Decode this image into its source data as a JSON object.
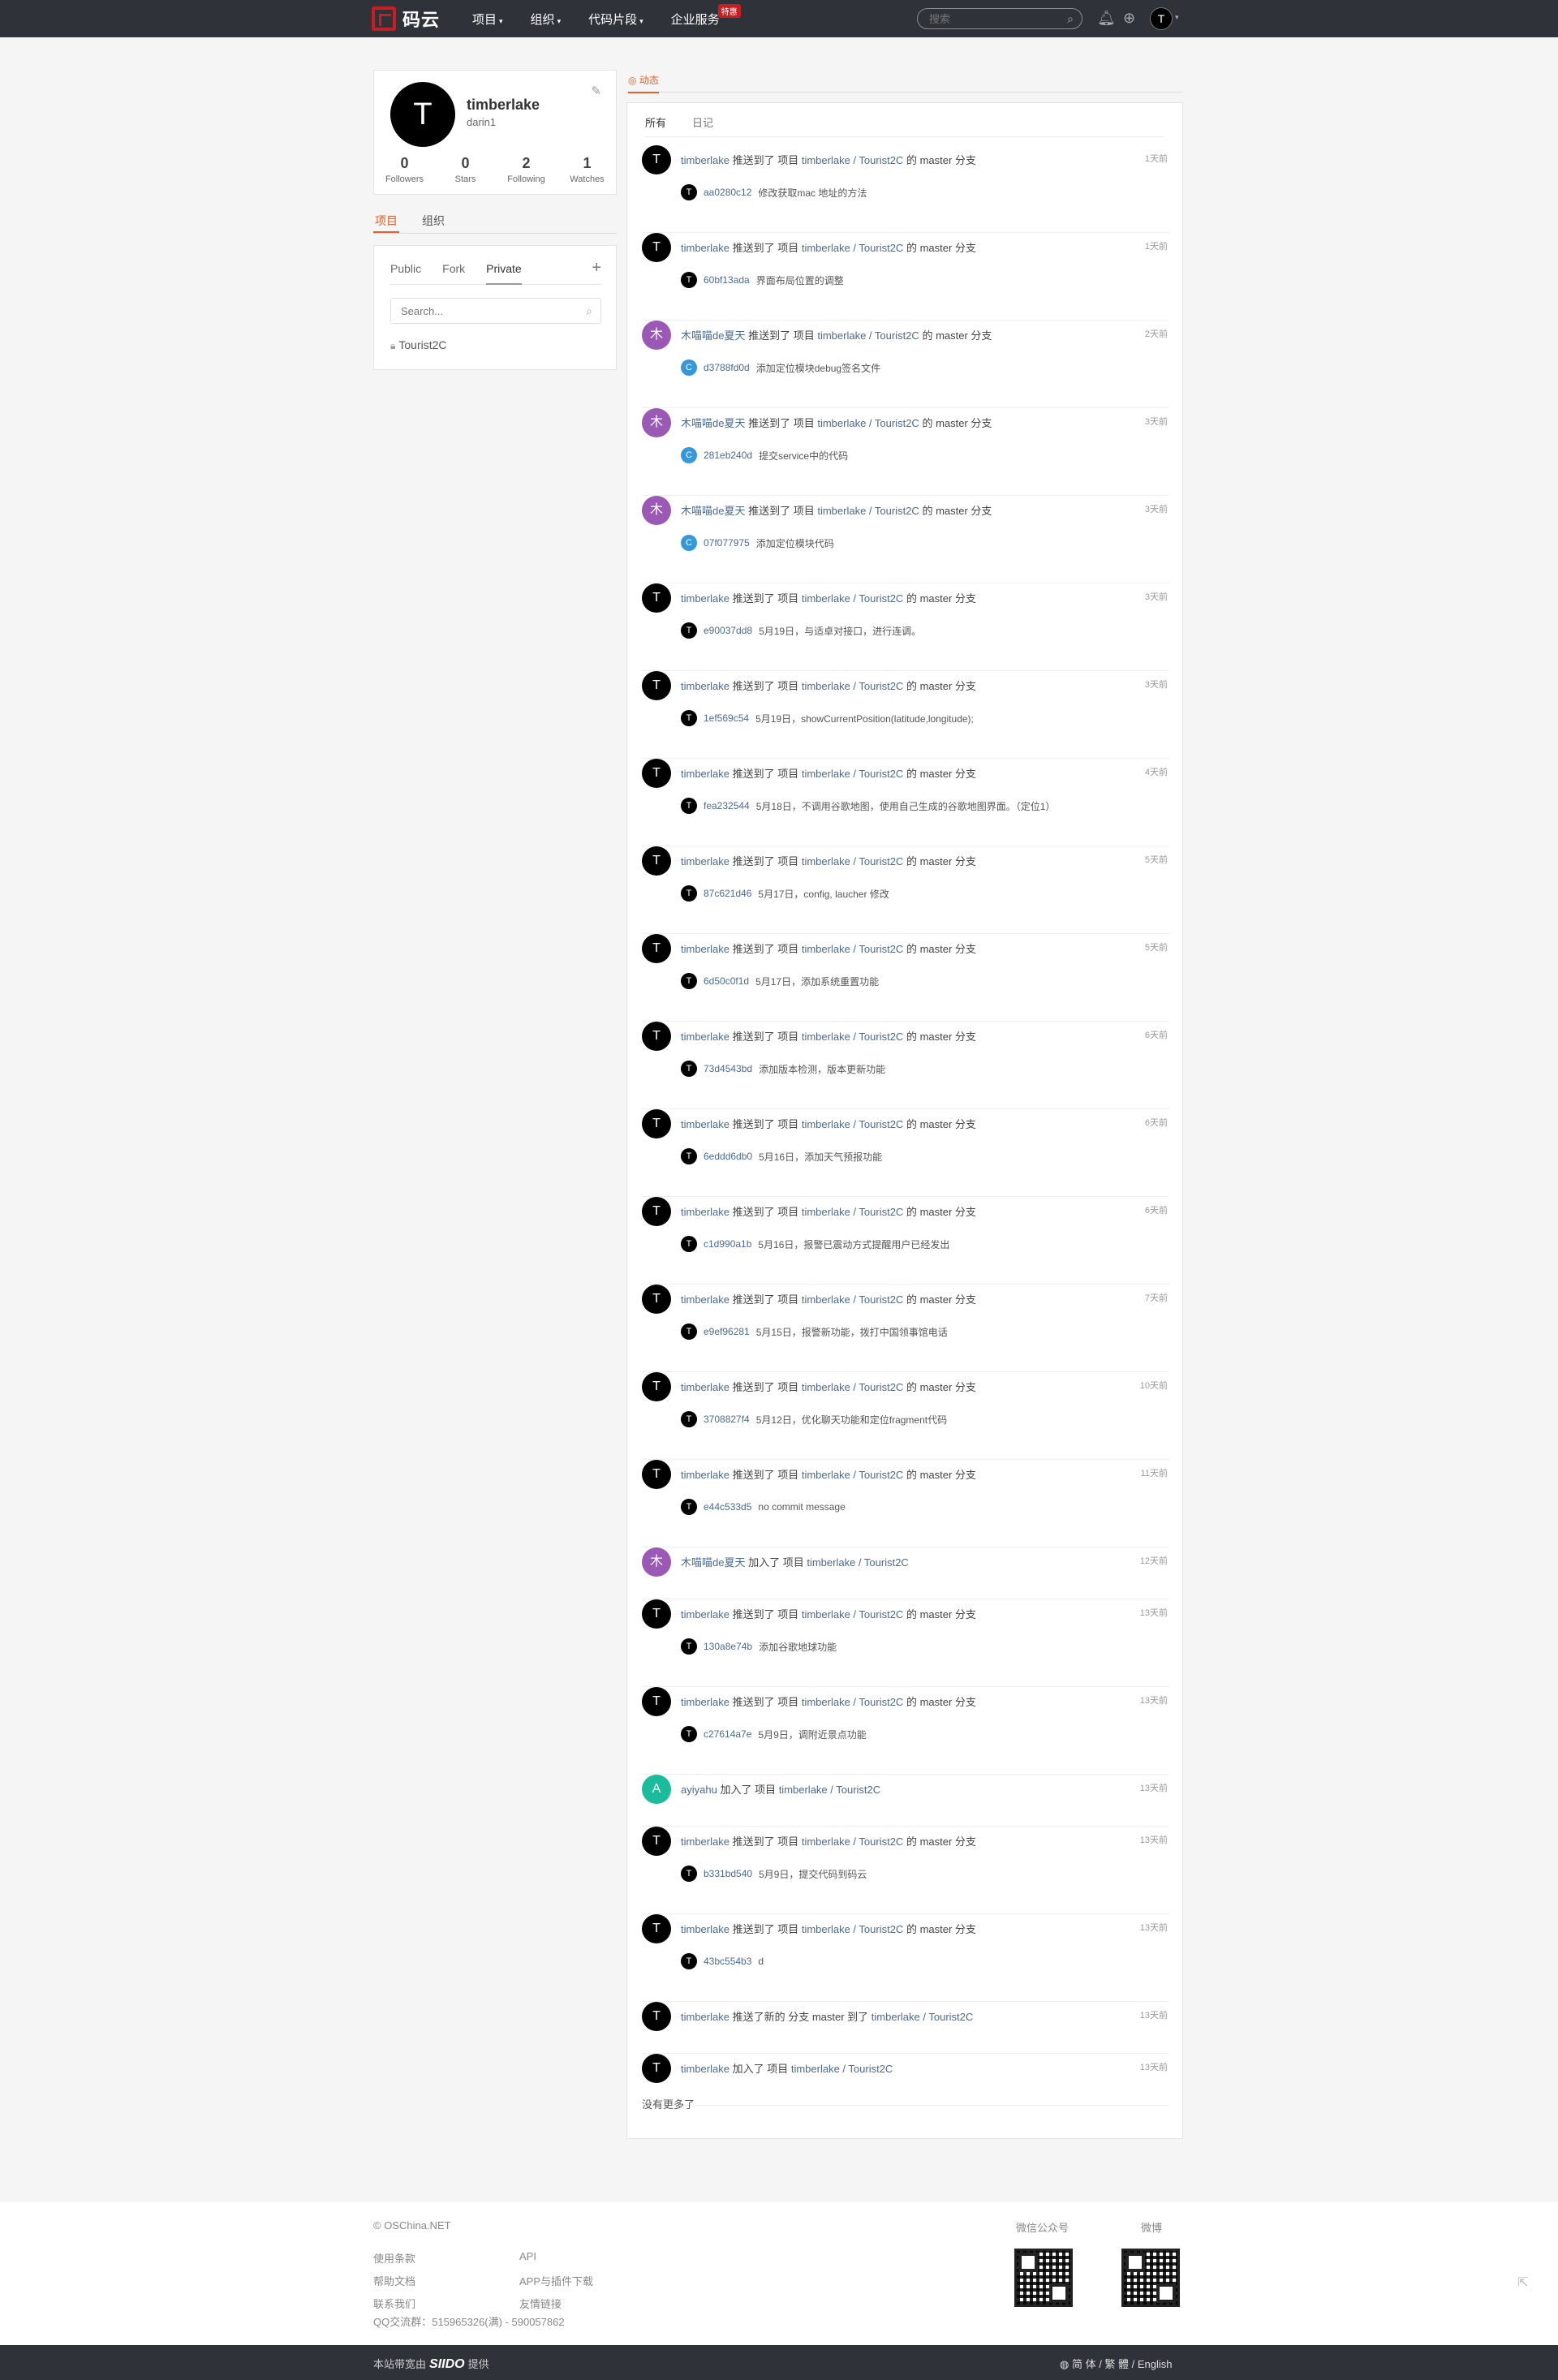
{
  "header": {
    "logo_text": "码云",
    "nav": [
      {
        "label": "项目"
      },
      {
        "label": "组织"
      },
      {
        "label": "代码片段"
      },
      {
        "label": "企业服务",
        "badge": "特惠"
      }
    ],
    "search_placeholder": "搜索",
    "user_avatar_letter": "T"
  },
  "profile": {
    "avatar_letter": "T",
    "name": "timberlake",
    "login": "darin1",
    "stats": [
      {
        "num": "0",
        "label": "Followers"
      },
      {
        "num": "0",
        "label": "Stars"
      },
      {
        "num": "2",
        "label": "Following"
      },
      {
        "num": "1",
        "label": "Watches"
      }
    ]
  },
  "side_tabs": [
    "项目",
    "组织"
  ],
  "repos": {
    "tabs": [
      "Public",
      "Fork",
      "Private"
    ],
    "search_placeholder": "Search...",
    "items": [
      "Tourist2C"
    ]
  },
  "main_tabs": [
    "动态"
  ],
  "sub_tabs": [
    "所有",
    "日记"
  ],
  "events": [
    {
      "av": "T",
      "color": "#000000",
      "actor": "timberlake",
      "verb": "推送到了 项目",
      "repo": "timberlake / Tourist2C",
      "tail": "的 master 分支",
      "time": "1天前",
      "sha": "aa0280c12",
      "msg": "修改获取mac 地址的方法",
      "cav": "T",
      "ccolor": "#000000"
    },
    {
      "av": "T",
      "color": "#000000",
      "actor": "timberlake",
      "verb": "推送到了 项目",
      "repo": "timberlake / Tourist2C",
      "tail": "的 master 分支",
      "time": "1天前",
      "sha": "60bf13ada",
      "msg": "界面布局位置的调整",
      "cav": "T",
      "ccolor": "#000000"
    },
    {
      "av": "木",
      "color": "#9b59b6",
      "actor": "木喵喵de夏天",
      "verb": "推送到了 项目",
      "repo": "timberlake / Tourist2C",
      "tail": "的 master 分支",
      "time": "2天前",
      "sha": "d3788fd0d",
      "msg": "添加定位模块debug签名文件",
      "cav": "C",
      "ccolor": "#3498db"
    },
    {
      "av": "木",
      "color": "#9b59b6",
      "actor": "木喵喵de夏天",
      "verb": "推送到了 项目",
      "repo": "timberlake / Tourist2C",
      "tail": "的 master 分支",
      "time": "3天前",
      "sha": "281eb240d",
      "msg": "提交service中的代码",
      "cav": "C",
      "ccolor": "#3498db"
    },
    {
      "av": "木",
      "color": "#9b59b6",
      "actor": "木喵喵de夏天",
      "verb": "推送到了 项目",
      "repo": "timberlake / Tourist2C",
      "tail": "的 master 分支",
      "time": "3天前",
      "sha": "07f077975",
      "msg": "添加定位模块代码",
      "cav": "C",
      "ccolor": "#3498db"
    },
    {
      "av": "T",
      "color": "#000000",
      "actor": "timberlake",
      "verb": "推送到了 项目",
      "repo": "timberlake / Tourist2C",
      "tail": "的 master 分支",
      "time": "3天前",
      "sha": "e90037dd8",
      "msg": "5月19日，与适卓对接口，进行连调。",
      "cav": "T",
      "ccolor": "#000000"
    },
    {
      "av": "T",
      "color": "#000000",
      "actor": "timberlake",
      "verb": "推送到了 项目",
      "repo": "timberlake / Tourist2C",
      "tail": "的 master 分支",
      "time": "3天前",
      "sha": "1ef569c54",
      "msg": "5月19日，showCurrentPosition(latitude,longitude);",
      "cav": "T",
      "ccolor": "#000000"
    },
    {
      "av": "T",
      "color": "#000000",
      "actor": "timberlake",
      "verb": "推送到了 项目",
      "repo": "timberlake / Tourist2C",
      "tail": "的 master 分支",
      "time": "4天前",
      "sha": "fea232544",
      "msg": "5月18日，不调用谷歌地图，使用自己生成的谷歌地图界面。（定位1）",
      "cav": "T",
      "ccolor": "#000000"
    },
    {
      "av": "T",
      "color": "#000000",
      "actor": "timberlake",
      "verb": "推送到了 项目",
      "repo": "timberlake / Tourist2C",
      "tail": "的 master 分支",
      "time": "5天前",
      "sha": "87c621d46",
      "msg": "5月17日，config, laucher 修改",
      "cav": "T",
      "ccolor": "#000000"
    },
    {
      "av": "T",
      "color": "#000000",
      "actor": "timberlake",
      "verb": "推送到了 项目",
      "repo": "timberlake / Tourist2C",
      "tail": "的 master 分支",
      "time": "5天前",
      "sha": "6d50c0f1d",
      "msg": "5月17日，添加系统重置功能",
      "cav": "T",
      "ccolor": "#000000"
    },
    {
      "av": "T",
      "color": "#000000",
      "actor": "timberlake",
      "verb": "推送到了 项目",
      "repo": "timberlake / Tourist2C",
      "tail": "的 master 分支",
      "time": "6天前",
      "sha": "73d4543bd",
      "msg": "添加版本检测，版本更新功能",
      "cav": "T",
      "ccolor": "#000000"
    },
    {
      "av": "T",
      "color": "#000000",
      "actor": "timberlake",
      "verb": "推送到了 项目",
      "repo": "timberlake / Tourist2C",
      "tail": "的 master 分支",
      "time": "6天前",
      "sha": "6eddd6db0",
      "msg": "5月16日，添加天气预报功能",
      "cav": "T",
      "ccolor": "#000000"
    },
    {
      "av": "T",
      "color": "#000000",
      "actor": "timberlake",
      "verb": "推送到了 项目",
      "repo": "timberlake / Tourist2C",
      "tail": "的 master 分支",
      "time": "6天前",
      "sha": "c1d990a1b",
      "msg": "5月16日，报警已震动方式提醒用户已经发出",
      "cav": "T",
      "ccolor": "#000000"
    },
    {
      "av": "T",
      "color": "#000000",
      "actor": "timberlake",
      "verb": "推送到了 项目",
      "repo": "timberlake / Tourist2C",
      "tail": "的 master 分支",
      "time": "7天前",
      "sha": "e9ef96281",
      "msg": "5月15日，报警新功能，拨打中国领事馆电话",
      "cav": "T",
      "ccolor": "#000000"
    },
    {
      "av": "T",
      "color": "#000000",
      "actor": "timberlake",
      "verb": "推送到了 项目",
      "repo": "timberlake / Tourist2C",
      "tail": "的 master 分支",
      "time": "10天前",
      "sha": "3708827f4",
      "msg": "5月12日，优化聊天功能和定位fragment代码",
      "cav": "T",
      "ccolor": "#000000"
    },
    {
      "av": "T",
      "color": "#000000",
      "actor": "timberlake",
      "verb": "推送到了 项目",
      "repo": "timberlake / Tourist2C",
      "tail": "的 master 分支",
      "time": "11天前",
      "sha": "e44c533d5",
      "msg": "no commit message",
      "cav": "T",
      "ccolor": "#000000"
    },
    {
      "av": "木",
      "color": "#9b59b6",
      "actor": "木喵喵de夏天",
      "verb": "加入了 项目",
      "repo": "timberlake / Tourist2C",
      "tail": "",
      "time": "12天前",
      "sha": "",
      "msg": "",
      "cav": "",
      "ccolor": ""
    },
    {
      "av": "T",
      "color": "#000000",
      "actor": "timberlake",
      "verb": "推送到了 项目",
      "repo": "timberlake / Tourist2C",
      "tail": "的 master 分支",
      "time": "13天前",
      "sha": "130a8e74b",
      "msg": "添加谷歌地球功能",
      "cav": "T",
      "ccolor": "#000000"
    },
    {
      "av": "T",
      "color": "#000000",
      "actor": "timberlake",
      "verb": "推送到了 项目",
      "repo": "timberlake / Tourist2C",
      "tail": "的 master 分支",
      "time": "13天前",
      "sha": "c27614a7e",
      "msg": "5月9日，调附近景点功能",
      "cav": "T",
      "ccolor": "#000000"
    },
    {
      "av": "A",
      "color": "#1abc9c",
      "actor": "ayiyahu",
      "verb": "加入了 项目",
      "repo": "timberlake / Tourist2C",
      "tail": "",
      "time": "13天前",
      "sha": "",
      "msg": "",
      "cav": "",
      "ccolor": ""
    },
    {
      "av": "T",
      "color": "#000000",
      "actor": "timberlake",
      "verb": "推送到了 项目",
      "repo": "timberlake / Tourist2C",
      "tail": "的 master 分支",
      "time": "13天前",
      "sha": "b331bd540",
      "msg": "5月9日，提交代码到码云",
      "cav": "T",
      "ccolor": "#000000"
    },
    {
      "av": "T",
      "color": "#000000",
      "actor": "timberlake",
      "verb": "推送到了 项目",
      "repo": "timberlake / Tourist2C",
      "tail": "的 master 分支",
      "time": "13天前",
      "sha": "43bc554b3",
      "msg": "d",
      "cav": "T",
      "ccolor": "#000000"
    },
    {
      "av": "T",
      "color": "#000000",
      "actor": "timberlake",
      "verb": "推送了新的 分支 master 到了",
      "repo": "timberlake / Tourist2C",
      "tail": "",
      "time": "13天前",
      "sha": "",
      "msg": "",
      "cav": "",
      "ccolor": ""
    },
    {
      "av": "T",
      "color": "#000000",
      "actor": "timberlake",
      "verb": "加入了 项目",
      "repo": "timberlake / Tourist2C",
      "tail": "",
      "time": "13天前",
      "sha": "",
      "msg": "",
      "cav": "",
      "ccolor": ""
    }
  ],
  "no_more": "没有更多了",
  "footer": {
    "copyright": "© OSChina.NET",
    "links": [
      "使用条款",
      "API",
      "帮助文档",
      "APP与插件下载",
      "联系我们",
      "友情链接"
    ],
    "qq": "QQ交流群：515965326(满) - 590057862",
    "qr_labels": [
      "微信公众号",
      "微博"
    ],
    "bottom_left_pre": "本站带宽由",
    "bottom_brand": "SIIDO",
    "bottom_left_post": "提供",
    "language": "简 体 / 繁 體 / English"
  }
}
